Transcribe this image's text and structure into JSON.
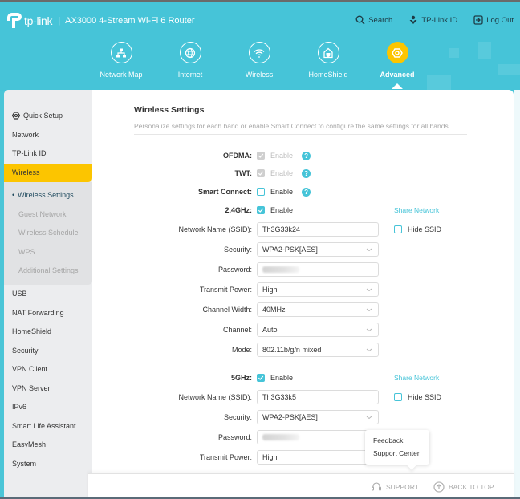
{
  "header": {
    "brand": "tp-link",
    "model": "AX3000 4-Stream Wi-Fi 6 Router",
    "links": [
      {
        "label": "Search",
        "icon": "search-icon"
      },
      {
        "label": "TP-Link ID",
        "icon": "user-icon"
      },
      {
        "label": "Log Out",
        "icon": "logout-icon"
      }
    ],
    "nav": [
      {
        "label": "Network Map",
        "icon": "network-map-icon"
      },
      {
        "label": "Internet",
        "icon": "globe-icon"
      },
      {
        "label": "Wireless",
        "icon": "wifi-icon"
      },
      {
        "label": "HomeShield",
        "icon": "homeshield-icon"
      },
      {
        "label": "Advanced",
        "icon": "advanced-gear-icon",
        "active": true
      }
    ]
  },
  "sidebar": {
    "items": [
      {
        "label": "Quick Setup",
        "icon": "gear-icon"
      },
      {
        "label": "Network"
      },
      {
        "label": "TP-Link ID"
      },
      {
        "label": "Wireless",
        "active": true
      },
      {
        "label": "USB"
      },
      {
        "label": "NAT Forwarding"
      },
      {
        "label": "HomeShield"
      },
      {
        "label": "Security"
      },
      {
        "label": "VPN Client"
      },
      {
        "label": "VPN Server"
      },
      {
        "label": "IPv6"
      },
      {
        "label": "Smart Life Assistant"
      },
      {
        "label": "EasyMesh"
      },
      {
        "label": "System"
      }
    ],
    "subitems": [
      {
        "label": "Wireless Settings",
        "current": true
      },
      {
        "label": "Guest Network"
      },
      {
        "label": "Wireless Schedule"
      },
      {
        "label": "WPS"
      },
      {
        "label": "Additional Settings"
      }
    ]
  },
  "main": {
    "title": "Wireless Settings",
    "description": "Personalize settings for each band or enable Smart Connect to configure the same settings for all bands.",
    "enable_label": "Enable",
    "share_network": "Share Network",
    "hide_ssid": "Hide SSID",
    "ofdma": {
      "label": "OFDMA:",
      "checked": true,
      "disabled": true
    },
    "twt": {
      "label": "TWT:",
      "checked": true,
      "disabled": true
    },
    "smart_connect": {
      "label": "Smart Connect:",
      "checked": false
    },
    "band24": {
      "label": "2.4GHz:",
      "enabled": true,
      "ssid_label": "Network Name (SSID):",
      "ssid": "Th3G33k24",
      "hide_ssid": false,
      "security_label": "Security:",
      "security": "WPA2-PSK[AES]",
      "password_label": "Password:",
      "password": "(blurred)",
      "tx_power_label": "Transmit Power:",
      "tx_power": "High",
      "channel_width_label": "Channel Width:",
      "channel_width": "40MHz",
      "channel_label": "Channel:",
      "channel": "Auto",
      "mode_label": "Mode:",
      "mode": "802.11b/g/n mixed"
    },
    "band5": {
      "label": "5GHz:",
      "enabled": true,
      "ssid_label": "Network Name (SSID):",
      "ssid": "Th3G33k5",
      "hide_ssid": false,
      "security_label": "Security:",
      "security": "WPA2-PSK[AES]",
      "password_label": "Password:",
      "password": "(blurred)",
      "tx_power_label": "Transmit Power:",
      "tx_power": "High"
    }
  },
  "support_popover": {
    "items": [
      "Feedback",
      "Support Center"
    ]
  },
  "footer": {
    "support": "SUPPORT",
    "back_to_top": "BACK TO TOP"
  },
  "colors": {
    "accent": "#46c4d8",
    "active": "#fcc500"
  }
}
